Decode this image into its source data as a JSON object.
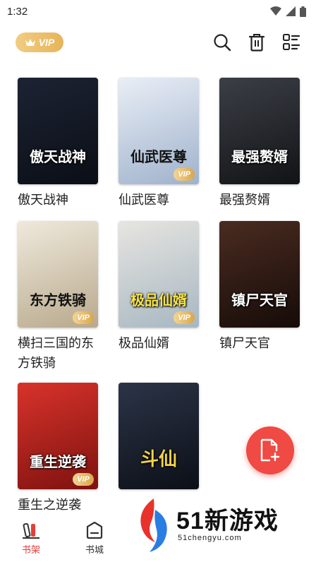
{
  "status": {
    "time": "1:32"
  },
  "topbar": {
    "vip_label": "VIP"
  },
  "books": [
    {
      "title": "傲天战神",
      "cover_text": "傲天战神",
      "badge": "",
      "c1": "#1c2333",
      "c2": "#0b0e16"
    },
    {
      "title": "仙武医尊",
      "cover_text": "仙武医尊",
      "badge": "VIP",
      "c1": "#e9eef6",
      "c2": "#9fb2cc"
    },
    {
      "title": "最强赘婿",
      "cover_text": "最强赘婿",
      "badge": "",
      "c1": "#3b3f46",
      "c2": "#121316"
    },
    {
      "title": "横扫三国的东方铁骑",
      "cover_text": "东方铁骑",
      "badge": "VIP",
      "c1": "#efe9dc",
      "c2": "#b8a98c"
    },
    {
      "title": "极品仙婿",
      "cover_text": "极品仙婿",
      "badge": "VIP",
      "c1": "#e7e5e0",
      "c2": "#a7b7c2"
    },
    {
      "title": "镇尸天官",
      "cover_text": "镇尸天官",
      "badge": "",
      "c1": "#4a2c21",
      "c2": "#160b08"
    },
    {
      "title": "重生之逆袭",
      "cover_text": "重生逆袭",
      "badge": "VIP",
      "c1": "#d8332b",
      "c2": "#7e120f"
    },
    {
      "title": "",
      "cover_text": "斗仙",
      "badge": "",
      "c1": "#2b3447",
      "c2": "#0c0f17"
    }
  ],
  "tabs": [
    {
      "label": "书架"
    },
    {
      "label": "书城"
    }
  ],
  "watermark": {
    "brand": "51新游戏",
    "url": "51chengyu.com"
  },
  "colors": {
    "accent": "#e4403a",
    "vip_gold": "#e6b45a"
  }
}
